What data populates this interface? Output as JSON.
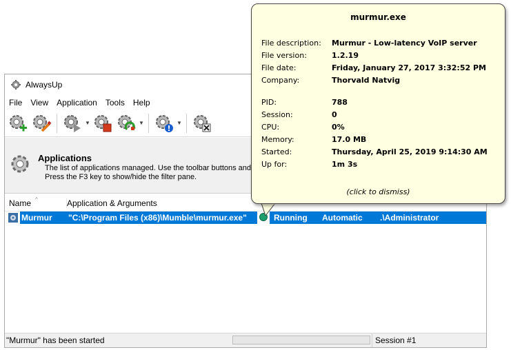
{
  "window": {
    "title": "AlwaysUp"
  },
  "menu": [
    "File",
    "View",
    "Application",
    "Tools",
    "Help"
  ],
  "toolbar": {
    "buttons": [
      {
        "name": "add-application-button",
        "icon": "gear-plus-icon"
      },
      {
        "name": "edit-application-button",
        "icon": "gear-pencil-icon"
      },
      {
        "name": "start-application-button",
        "icon": "gear-start-icon"
      },
      {
        "name": "stop-application-button",
        "icon": "gear-stop-icon"
      },
      {
        "name": "restart-application-button",
        "icon": "gear-restart-icon"
      },
      {
        "name": "report-activity-button",
        "icon": "gear-info-icon"
      },
      {
        "name": "remove-application-button",
        "icon": "gear-delete-icon"
      }
    ]
  },
  "header": {
    "title": "Applications",
    "desc_line1": "The list of applications managed. Use the toolbar buttons and m",
    "desc_line2": "Press the F3 key to show/hide the filter pane."
  },
  "columns": {
    "name": "Name",
    "args": "Application & Arguments"
  },
  "rows": [
    {
      "name": "Murmur",
      "args": "\"C:\\Program Files (x86)\\Mumble\\murmur.exe\"",
      "status": "Running",
      "startup": "Automatic",
      "user": ".\\Administrator",
      "status_color": "#1f9e6d"
    }
  ],
  "statusbar": {
    "message": "\"Murmur\" has been started",
    "session": "Session #1",
    "progress": 0
  },
  "tooltip": {
    "title": "murmur.exe",
    "fields": [
      {
        "label": "File description:",
        "value": "Murmur - Low-latency VoIP server"
      },
      {
        "label": "File version:",
        "value": "1.2.19"
      },
      {
        "label": "File date:",
        "value": "Friday, January 27, 2017 3:32:52 PM"
      },
      {
        "label": "Company:",
        "value": "Thorvald Natvig"
      },
      {
        "label": "PID:",
        "value": "788"
      },
      {
        "label": "Session:",
        "value": "0"
      },
      {
        "label": "CPU:",
        "value": "0%"
      },
      {
        "label": "Memory:",
        "value": "17.0 MB"
      },
      {
        "label": "Started:",
        "value": "Thursday, April 25, 2019 9:14:30 AM"
      },
      {
        "label": "Up for:",
        "value": "1m 3s"
      }
    ],
    "dismiss": "(click to dismiss)"
  },
  "colors": {
    "selection": "#0078d7",
    "tooltip_bg": "#ffffe1",
    "header_bg": "#f0f0f0"
  }
}
